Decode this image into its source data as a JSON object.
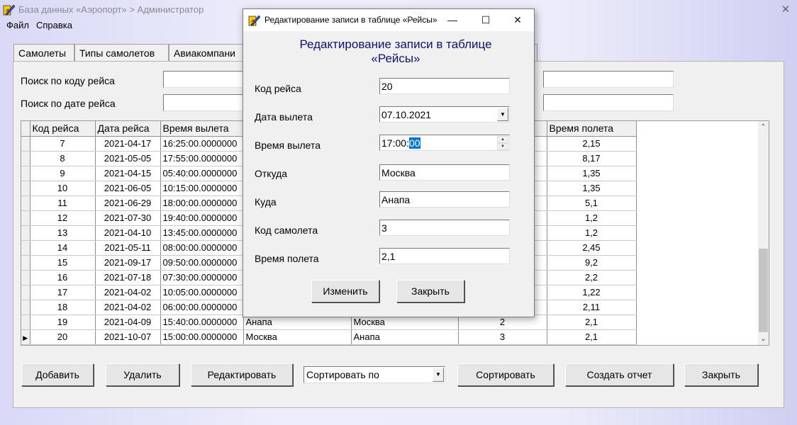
{
  "main_window": {
    "title": "База данных «Аэропорт» > Администратор",
    "close_glyph": "✕"
  },
  "menu": [
    "Файл",
    "Справка"
  ],
  "tabs": [
    "Самолеты",
    "Типы самолетов",
    "Авиакомпани"
  ],
  "search": {
    "by_code_label": "Поиск по коду рейса",
    "by_date_label": "Поиск по дате рейса"
  },
  "grid": {
    "columns": [
      "Код рейса",
      "Дата рейса",
      "Время вылета",
      "",
      "",
      "",
      "Время полета"
    ],
    "rows": [
      {
        "code": "7",
        "date": "2021-04-17",
        "time": "16:25:00.0000000",
        "from": "",
        "to": "",
        "plane": "",
        "duration": "2,15"
      },
      {
        "code": "8",
        "date": "2021-05-05",
        "time": "17:55:00.0000000",
        "from": "",
        "to": "",
        "plane": "",
        "duration": "8,17"
      },
      {
        "code": "9",
        "date": "2021-04-15",
        "time": "05:40:00.0000000",
        "from": "",
        "to": "",
        "plane": "",
        "duration": "1,35"
      },
      {
        "code": "10",
        "date": "2021-06-05",
        "time": "10:15:00.0000000",
        "from": "",
        "to": "",
        "plane": "",
        "duration": "1,35"
      },
      {
        "code": "11",
        "date": "2021-06-29",
        "time": "18:00:00.0000000",
        "from": "",
        "to": "",
        "plane": "",
        "duration": "5,1"
      },
      {
        "code": "12",
        "date": "2021-07-30",
        "time": "19:40:00.0000000",
        "from": "",
        "to": "",
        "plane": "",
        "duration": "1,2"
      },
      {
        "code": "13",
        "date": "2021-04-10",
        "time": "13:45:00.0000000",
        "from": "",
        "to": "",
        "plane": "",
        "duration": "1,2"
      },
      {
        "code": "14",
        "date": "2021-05-11",
        "time": "08:00:00.0000000",
        "from": "",
        "to": "",
        "plane": "",
        "duration": "2,45"
      },
      {
        "code": "15",
        "date": "2021-09-17",
        "time": "09:50:00.0000000",
        "from": "",
        "to": "",
        "plane": "",
        "duration": "9,2"
      },
      {
        "code": "16",
        "date": "2021-07-18",
        "time": "07:30:00.0000000",
        "from": "",
        "to": "",
        "plane": "",
        "duration": "2,2"
      },
      {
        "code": "17",
        "date": "2021-04-02",
        "time": "10:05:00.0000000",
        "from": "",
        "to": "",
        "plane": "",
        "duration": "1,22"
      },
      {
        "code": "18",
        "date": "2021-04-02",
        "time": "06:00:00.0000000",
        "from": "",
        "to": "",
        "plane": "",
        "duration": "2,11"
      },
      {
        "code": "19",
        "date": "2021-04-09",
        "time": "15:40:00.0000000",
        "from": "Анапа",
        "to": "Москва",
        "plane": "2",
        "duration": "2,1"
      },
      {
        "code": "20",
        "date": "2021-10-07",
        "time": "15:00:00.0000000",
        "from": "Москва",
        "to": "Анапа",
        "plane": "3",
        "duration": "2,1"
      }
    ],
    "current_row_marker": "▶"
  },
  "buttons": {
    "add": "Добавить",
    "delete": "Удалить",
    "edit": "Редактировать",
    "sort_by": "Сортировать по",
    "sort": "Сортировать",
    "report": "Создать отчет",
    "close": "Закрыть"
  },
  "dialog": {
    "title": "Редактирование записи в таблице «Рейсы»",
    "heading_line1": "Редактирование записи в таблице",
    "heading_line2": "«Рейсы»",
    "minimize_glyph": "—",
    "maximize_glyph": "☐",
    "close_glyph": "✕",
    "fields": {
      "code_label": "Код рейса",
      "code_value": "20",
      "date_label": "Дата вылета",
      "date_value": "07.10.2021",
      "time_label": "Время вылета",
      "time_value_prefix": "17:00:",
      "time_value_selected": "00",
      "from_label": "Откуда",
      "from_value": "Москва",
      "to_label": "Куда",
      "to_value": "Анапа",
      "plane_label": "Код самолета",
      "plane_value": "3",
      "duration_label": "Время полета",
      "duration_value": "2,1"
    },
    "change_button": "Изменить",
    "close_button": "Закрыть"
  },
  "colors": {
    "dialog_heading": "#0c1373",
    "selection": "#0078d7",
    "window_face": "#f0f0f0"
  }
}
